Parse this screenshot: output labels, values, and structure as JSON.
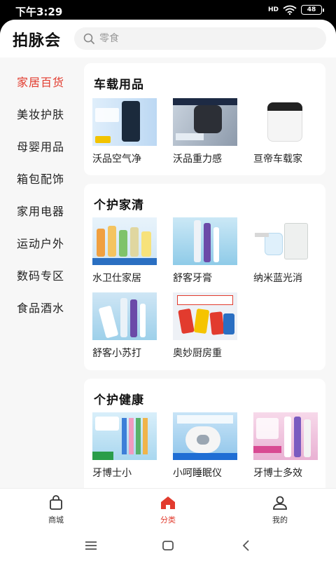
{
  "status": {
    "time": "下午3:29",
    "signal": "HD",
    "battery": "48"
  },
  "header": {
    "brand": "拍脉会",
    "search_placeholder": "零食"
  },
  "sidebar": {
    "items": [
      {
        "label": "家居百货",
        "active": true
      },
      {
        "label": "美妆护肤"
      },
      {
        "label": "母婴用品"
      },
      {
        "label": "箱包配饰"
      },
      {
        "label": "家用电器"
      },
      {
        "label": "运动户外"
      },
      {
        "label": "数码专区"
      },
      {
        "label": "食品酒水"
      }
    ]
  },
  "sections": [
    {
      "title": "车载用品",
      "items": [
        {
          "name": "沃品空气净"
        },
        {
          "name": "沃品重力感"
        },
        {
          "name": "亘帝车载家"
        }
      ]
    },
    {
      "title": "个护家清",
      "items": [
        {
          "name": "水卫仕家居"
        },
        {
          "name": "舒客牙膏"
        },
        {
          "name": "纳米蓝光消"
        },
        {
          "name": "舒客小苏打"
        },
        {
          "name": "奥妙厨房重"
        }
      ]
    },
    {
      "title": "个护健康",
      "items": [
        {
          "name": "牙博士小"
        },
        {
          "name": "小呵睡眠仪"
        },
        {
          "name": "牙博士多效"
        }
      ]
    }
  ],
  "tabbar": {
    "items": [
      {
        "label": "商城",
        "icon": "bag-icon"
      },
      {
        "label": "分类",
        "icon": "home-icon",
        "active": true
      },
      {
        "label": "我的",
        "icon": "user-icon"
      }
    ]
  },
  "colors": {
    "accent": "#e23b2e",
    "bg": "#f7f7f7"
  }
}
